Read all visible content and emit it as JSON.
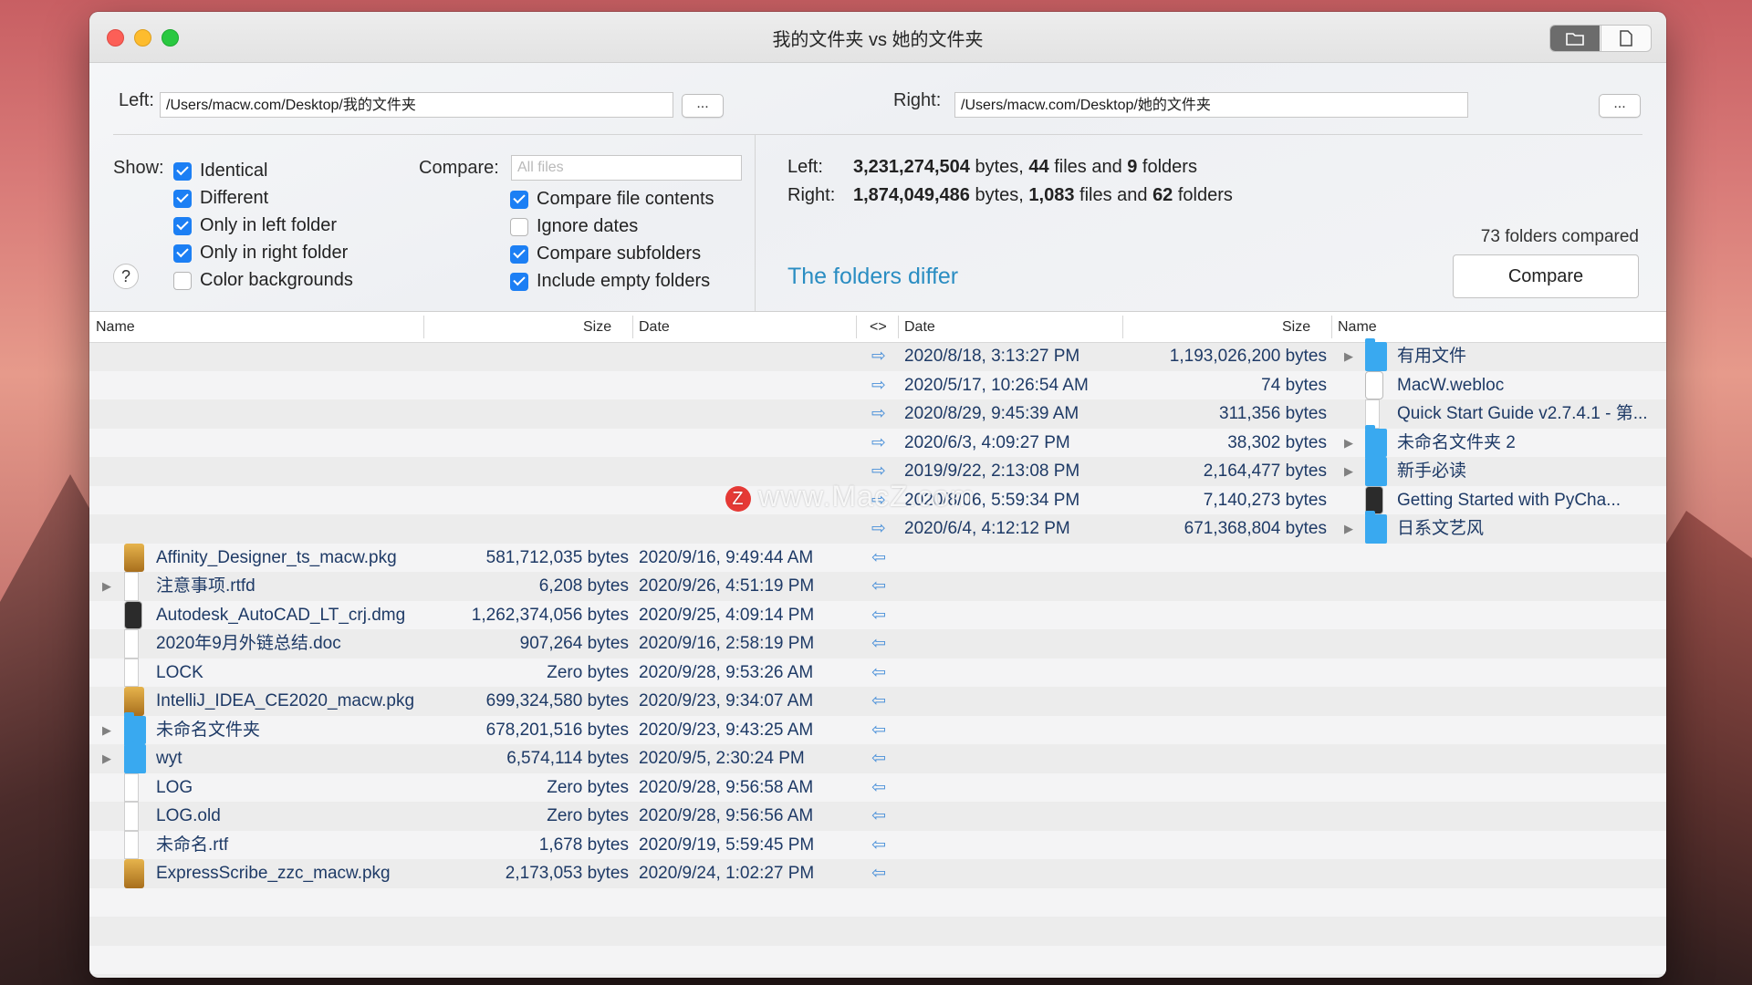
{
  "window": {
    "title": "我的文件夹 vs 她的文件夹"
  },
  "paths": {
    "left_label": "Left:",
    "left_path": "/Users/macw.com/Desktop/我的文件夹",
    "right_label": "Right:",
    "right_path": "/Users/macw.com/Desktop/她的文件夹",
    "browse": "..."
  },
  "show": {
    "label": "Show:",
    "items": [
      {
        "label": "Identical",
        "checked": true
      },
      {
        "label": "Different",
        "checked": true
      },
      {
        "label": "Only in left folder",
        "checked": true
      },
      {
        "label": "Only in right folder",
        "checked": true
      },
      {
        "label": "Color backgrounds",
        "checked": false
      }
    ],
    "help": "?"
  },
  "compare": {
    "label": "Compare:",
    "filter_placeholder": "All files",
    "items": [
      {
        "label": "Compare file contents",
        "checked": true
      },
      {
        "label": "Ignore dates",
        "checked": false
      },
      {
        "label": "Compare subfolders",
        "checked": true
      },
      {
        "label": "Include empty folders",
        "checked": true
      }
    ]
  },
  "stats": {
    "left_label": "Left:",
    "left_bytes": "3,231,274,504",
    "left_files": "44",
    "left_folders": "9",
    "right_label": "Right:",
    "right_bytes": "1,874,049,486",
    "right_files": "1,083",
    "right_folders": "62",
    "bytes_word": " bytes, ",
    "files_word": " files and ",
    "folders_word": " folders",
    "status": "The folders differ",
    "folders_compared": "73 folders compared",
    "compare_button": "Compare"
  },
  "columns": {
    "name": "Name",
    "size": "Size",
    "date": "Date",
    "arrow": "<>",
    "rdate": "Date",
    "rsize": "Size",
    "rname": "Name"
  },
  "rows": [
    {
      "side": "right",
      "date": "2020/8/18, 3:13:27 PM",
      "size": "1,193,026,200 bytes",
      "name": "有用文件",
      "icon": "folder-icon",
      "expand": true
    },
    {
      "side": "right",
      "date": "2020/5/17, 10:26:54 AM",
      "size": "74 bytes",
      "name": "MacW.webloc",
      "icon": "webloc-icon",
      "expand": false
    },
    {
      "side": "right",
      "date": "2020/8/29, 9:45:39 AM",
      "size": "311,356 bytes",
      "name": "Quick Start Guide v2.7.4.1 - 第...",
      "icon": "document-icon",
      "expand": false
    },
    {
      "side": "right",
      "date": "2020/6/3, 4:09:27 PM",
      "size": "38,302 bytes",
      "name": "未命名文件夹 2",
      "icon": "folder-icon",
      "expand": true
    },
    {
      "side": "right",
      "date": "2019/9/22, 2:13:08 PM",
      "size": "2,164,477 bytes",
      "name": "新手必读",
      "icon": "folder-icon",
      "expand": true
    },
    {
      "side": "right",
      "date": "2020/8/06, 5:59:34 PM",
      "size": "7,140,273 bytes",
      "name": "Getting Started with PyCha...",
      "icon": "app-icon",
      "expand": false
    },
    {
      "side": "right",
      "date": "2020/6/4, 4:12:12 PM",
      "size": "671,368,804 bytes",
      "name": "日系文艺风",
      "icon": "folder-icon",
      "expand": true
    },
    {
      "side": "left",
      "name": "Affinity_Designer_ts_macw.pkg",
      "size": "581,712,035 bytes",
      "date": "2020/9/16, 9:49:44 AM",
      "icon": "package-icon",
      "expand": false
    },
    {
      "side": "left",
      "name": "注意事项.rtfd",
      "size": "6,208 bytes",
      "date": "2020/9/26, 4:51:19 PM",
      "icon": "document-icon",
      "expand": true
    },
    {
      "side": "left",
      "name": "Autodesk_AutoCAD_LT_crj.dmg",
      "size": "1,262,374,056 bytes",
      "date": "2020/9/25, 4:09:14 PM",
      "icon": "disk-image-icon",
      "expand": false
    },
    {
      "side": "left",
      "name": "2020年9月外链总结.doc",
      "size": "907,264 bytes",
      "date": "2020/9/16, 2:58:19 PM",
      "icon": "document-icon",
      "expand": false
    },
    {
      "side": "left",
      "name": "LOCK",
      "size": "Zero bytes",
      "date": "2020/9/28, 9:53:26 AM",
      "icon": "document-icon",
      "expand": false
    },
    {
      "side": "left",
      "name": "IntelliJ_IDEA_CE2020_macw.pkg",
      "size": "699,324,580 bytes",
      "date": "2020/9/23, 9:34:07 AM",
      "icon": "package-icon",
      "expand": false
    },
    {
      "side": "left",
      "name": "未命名文件夹",
      "size": "678,201,516 bytes",
      "date": "2020/9/23, 9:43:25 AM",
      "icon": "folder-icon",
      "expand": true
    },
    {
      "side": "left",
      "name": "wyt",
      "size": "6,574,114 bytes",
      "date": "2020/9/5, 2:30:24 PM",
      "icon": "folder-icon",
      "expand": true
    },
    {
      "side": "left",
      "name": "LOG",
      "size": "Zero bytes",
      "date": "2020/9/28, 9:56:58 AM",
      "icon": "document-icon",
      "expand": false
    },
    {
      "side": "left",
      "name": "LOG.old",
      "size": "Zero bytes",
      "date": "2020/9/28, 9:56:56 AM",
      "icon": "document-icon",
      "expand": false
    },
    {
      "side": "left",
      "name": "未命名.rtf",
      "size": "1,678 bytes",
      "date": "2020/9/19, 5:59:45 PM",
      "icon": "document-icon",
      "expand": false
    },
    {
      "side": "left",
      "name": "ExpressScribe_zzc_macw.pkg",
      "size": "2,173,053 bytes",
      "date": "2020/9/24, 1:02:27 PM",
      "icon": "package-icon",
      "expand": false
    }
  ],
  "arrows": {
    "right_only": "⇨",
    "left_only": "⇦"
  },
  "watermark": {
    "badge": "Z",
    "text": "www.MacZ.com"
  },
  "colors": {
    "accent": "#1c7ff4",
    "status": "#2a8dc2",
    "folder": "#39a9f0",
    "rowtext": "#1e3a66"
  }
}
